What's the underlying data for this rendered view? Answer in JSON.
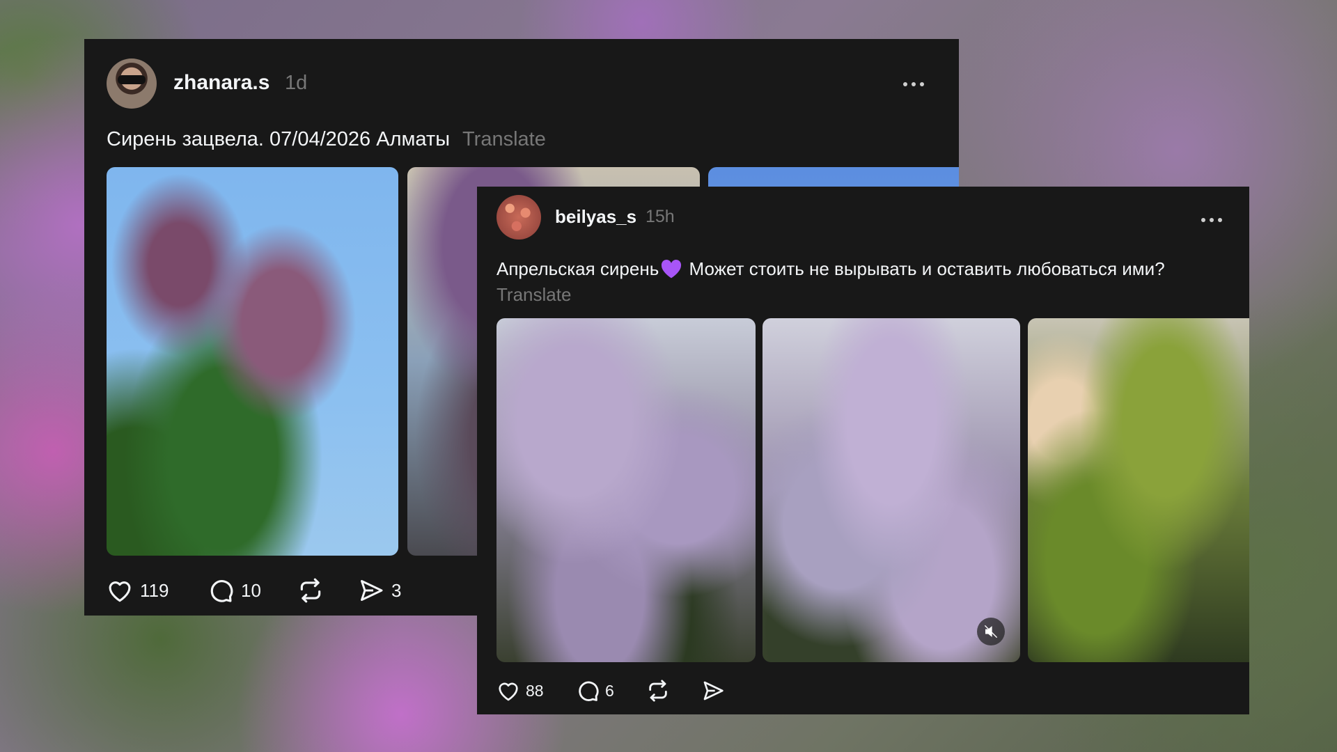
{
  "posts": [
    {
      "username": "zhanara.s",
      "time": "1d",
      "caption": "Сирень зацвела. 07/04/2026 Алматы",
      "translate_label": "Translate",
      "likes": "119",
      "comments": "10",
      "shares": "3"
    },
    {
      "username": "beilyas_s",
      "time": "15h",
      "caption_before": "Апрельская сирень",
      "caption_after": " Может стоить не вырывать и оставить любоваться ими?",
      "emoji": "purple-heart-emoji",
      "translate_label": "Translate",
      "likes": "88",
      "comments": "6"
    }
  ],
  "colors": {
    "card_bg": "#181818",
    "text_primary": "#f3f5f7",
    "text_secondary": "#777777",
    "emoji_purple": "#a855f7"
  },
  "icons": [
    "heart-icon",
    "comment-icon",
    "repost-icon",
    "share-icon",
    "more-icon",
    "mute-icon"
  ]
}
